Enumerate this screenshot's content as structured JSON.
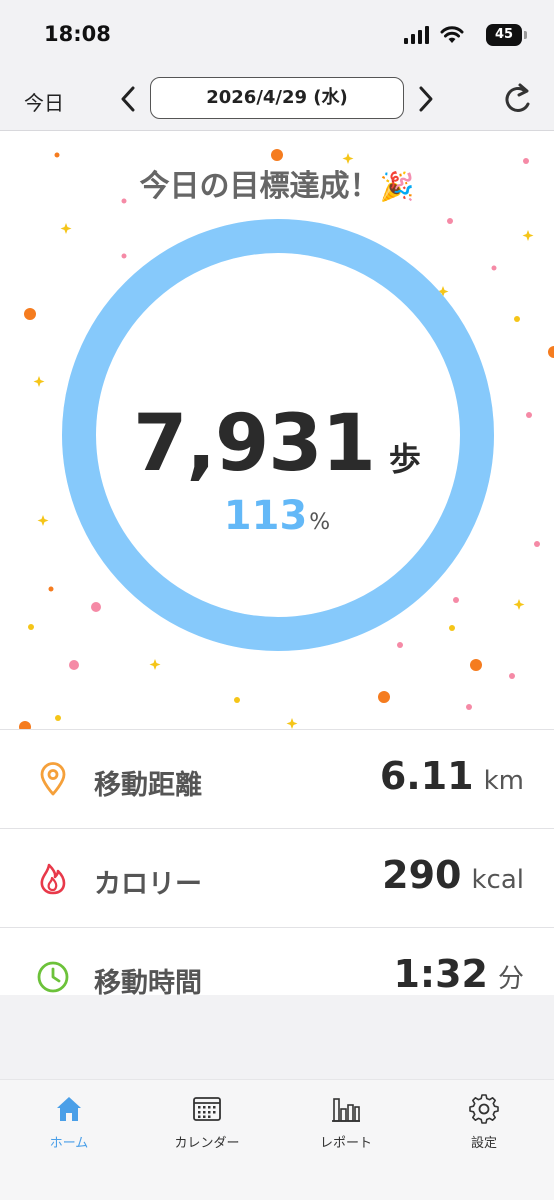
{
  "status_bar": {
    "time": "18:08",
    "battery": "45"
  },
  "nav": {
    "today_label": "今日",
    "date": "2026/4/29 (水)"
  },
  "hero": {
    "banner": "今日の目標達成！",
    "steps": "7,931",
    "step_unit": "歩",
    "percent": "113",
    "percent_sign": "%",
    "progress_fraction": 1.13,
    "ring_color": "#86c9fb"
  },
  "stats": [
    {
      "icon": "location-pin-icon",
      "label": "移動距離",
      "value": "6.11",
      "unit": "km",
      "icon_color": "#f5a03a"
    },
    {
      "icon": "flame-icon",
      "label": "カロリー",
      "value": "290",
      "unit": "kcal",
      "icon_color": "#e8394a"
    },
    {
      "icon": "clock-icon",
      "label": "移動時間",
      "value": "1:32",
      "unit": "分",
      "icon_color": "#6cc23a"
    }
  ],
  "tabs": [
    {
      "label": "ホーム",
      "icon": "home-icon",
      "active": true
    },
    {
      "label": "カレンダー",
      "icon": "calendar-icon",
      "active": false
    },
    {
      "label": "レポート",
      "icon": "bar-chart-icon",
      "active": false
    },
    {
      "label": "設定",
      "icon": "gear-icon",
      "active": false
    }
  ],
  "colors": {
    "accent": "#4a9fe8",
    "percent": "#63b8f7"
  }
}
